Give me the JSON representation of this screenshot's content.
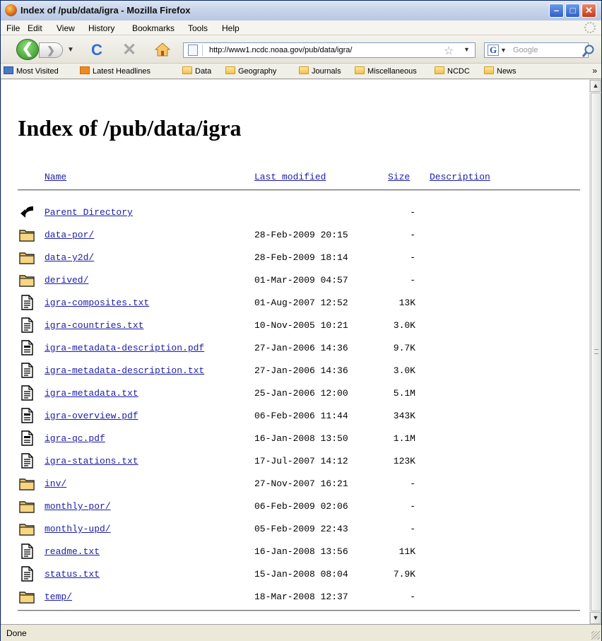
{
  "window": {
    "title": "Index of /pub/data/igra - Mozilla Firefox",
    "min_glyph": "–",
    "max_glyph": "□",
    "close_glyph": "✕"
  },
  "menu": {
    "file": "File",
    "edit": "Edit",
    "view": "View",
    "history": "History",
    "bookmarks": "Bookmarks",
    "tools": "Tools",
    "help": "Help"
  },
  "nav": {
    "back_glyph": "❮",
    "forward_glyph": "❯",
    "url": "http://www1.ncdc.noaa.gov/pub/data/igra/",
    "search_placeholder": "Google",
    "search_engine_letter": "G"
  },
  "bookmarks": {
    "most_visited": "Most Visited",
    "latest_headlines": "Latest Headlines",
    "data": "Data",
    "geography": "Geography",
    "journals": "Journals",
    "miscellaneous": "Miscellaneous",
    "ncdc": "NCDC",
    "news": "News",
    "overflow": "»"
  },
  "listing": {
    "title": "Index of /pub/data/igra",
    "headers": {
      "name": "Name",
      "modified": "Last modified",
      "size": "Size",
      "description": "Description"
    },
    "entries": [
      {
        "name": "Parent Directory",
        "date": "",
        "size": "-",
        "icon": "back-icon"
      },
      {
        "name": "data-por/",
        "date": "28-Feb-2009 20:15",
        "size": "-",
        "icon": "folder-icon"
      },
      {
        "name": "data-y2d/",
        "date": "28-Feb-2009 18:14",
        "size": "-",
        "icon": "folder-icon"
      },
      {
        "name": "derived/",
        "date": "01-Mar-2009 04:57",
        "size": "-",
        "icon": "folder-icon"
      },
      {
        "name": "igra-composites.txt",
        "date": "01-Aug-2007 12:52",
        "size": "13K",
        "icon": "text-file-icon"
      },
      {
        "name": "igra-countries.txt",
        "date": "10-Nov-2005 10:21",
        "size": "3.0K",
        "icon": "text-file-icon"
      },
      {
        "name": "igra-metadata-description.pdf",
        "date": "27-Jan-2006 14:36",
        "size": "9.7K",
        "icon": "file-icon"
      },
      {
        "name": "igra-metadata-description.txt",
        "date": "27-Jan-2006 14:36",
        "size": "3.0K",
        "icon": "text-file-icon"
      },
      {
        "name": "igra-metadata.txt",
        "date": "25-Jan-2006 12:00",
        "size": "5.1M",
        "icon": "text-file-icon"
      },
      {
        "name": "igra-overview.pdf",
        "date": "06-Feb-2006 11:44",
        "size": "343K",
        "icon": "file-icon"
      },
      {
        "name": "igra-qc.pdf",
        "date": "16-Jan-2008 13:50",
        "size": "1.1M",
        "icon": "file-icon"
      },
      {
        "name": "igra-stations.txt",
        "date": "17-Jul-2007 14:12",
        "size": "123K",
        "icon": "text-file-icon"
      },
      {
        "name": "inv/",
        "date": "27-Nov-2007 16:21",
        "size": "-",
        "icon": "folder-icon"
      },
      {
        "name": "monthly-por/",
        "date": "06-Feb-2009 02:06",
        "size": "-",
        "icon": "folder-icon"
      },
      {
        "name": "monthly-upd/",
        "date": "05-Feb-2009 22:43",
        "size": "-",
        "icon": "folder-icon"
      },
      {
        "name": "readme.txt",
        "date": "16-Jan-2008 13:56",
        "size": "11K",
        "icon": "text-file-icon"
      },
      {
        "name": "status.txt",
        "date": "15-Jan-2008 08:04",
        "size": "7.9K",
        "icon": "text-file-icon"
      },
      {
        "name": "temp/",
        "date": "18-Mar-2008 12:37",
        "size": "-",
        "icon": "folder-icon"
      }
    ]
  },
  "status": {
    "text": "Done"
  }
}
